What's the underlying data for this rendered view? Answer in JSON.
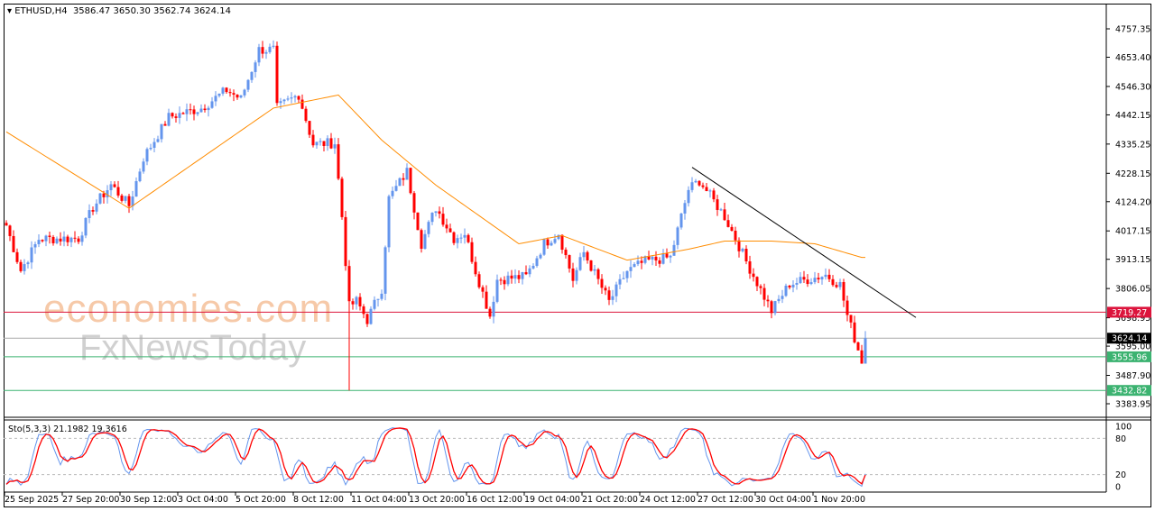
{
  "header": {
    "symbol": "ETHUSD,H4",
    "open": "3586.47",
    "high": "3650.30",
    "low": "3562.74",
    "close": "3624.14"
  },
  "watermarks": [
    "economies.com",
    "FxNewsToday"
  ],
  "colors": {
    "bull": "#6495ed",
    "bear": "#ff0000",
    "ma": "#ff8c00",
    "level_red": "#dc143c",
    "level_green": "#3cb371",
    "current": "#000000"
  },
  "chart_data": {
    "type": "candlestick",
    "symbol": "ETHUSD",
    "timeframe": "H4",
    "ylim": [
      3383.95,
      4757.35
    ],
    "y_ticks": [
      "4757.35",
      "4653.40",
      "4546.30",
      "4442.15",
      "4335.25",
      "4228.15",
      "4124.20",
      "4017.15",
      "3913.15",
      "3806.05",
      "3698.95",
      "3595.00",
      "3487.90",
      "3383.95"
    ],
    "x_ticks": [
      "25 Sep 2025",
      "27 Sep 20:00",
      "30 Sep 12:00",
      "3 Oct 04:00",
      "5 Oct 20:00",
      "8 Oct 12:00",
      "11 Oct 04:00",
      "13 Oct 20:00",
      "16 Oct 12:00",
      "19 Oct 04:00",
      "21 Oct 20:00",
      "24 Oct 12:00",
      "27 Oct 12:00",
      "30 Oct 04:00",
      "1 Nov 20:00"
    ],
    "price_path_candle_index_vs_price": [
      [
        0,
        4037
      ],
      [
        4,
        3872
      ],
      [
        9,
        3988
      ],
      [
        20,
        3990
      ],
      [
        24,
        4103
      ],
      [
        29,
        4186
      ],
      [
        34,
        4110
      ],
      [
        38,
        4285
      ],
      [
        45,
        4434
      ],
      [
        54,
        4467
      ],
      [
        61,
        4533
      ],
      [
        65,
        4500
      ],
      [
        70,
        4681
      ],
      [
        74,
        4681
      ],
      [
        75,
        4467
      ],
      [
        81,
        4517
      ],
      [
        85,
        4335
      ],
      [
        91,
        4340
      ],
      [
        93,
        4070
      ],
      [
        95,
        3740
      ],
      [
        97,
        3760
      ],
      [
        100,
        3691
      ],
      [
        104,
        3806
      ],
      [
        106,
        4136
      ],
      [
        111,
        4235
      ],
      [
        115,
        3971
      ],
      [
        119,
        4103
      ],
      [
        124,
        3990
      ],
      [
        127,
        4010
      ],
      [
        130,
        3872
      ],
      [
        134,
        3707
      ],
      [
        136,
        3839
      ],
      [
        144,
        3850
      ],
      [
        149,
        3971
      ],
      [
        153,
        4010
      ],
      [
        157,
        3839
      ],
      [
        160,
        3938
      ],
      [
        167,
        3757
      ],
      [
        172,
        3870
      ],
      [
        177,
        3905
      ],
      [
        184,
        3920
      ],
      [
        189,
        4169
      ],
      [
        192,
        4202
      ],
      [
        199,
        4070
      ],
      [
        202,
        3990
      ],
      [
        205,
        3905
      ],
      [
        212,
        3724
      ],
      [
        217,
        3823
      ],
      [
        227,
        3856
      ],
      [
        231,
        3820
      ],
      [
        233,
        3707
      ],
      [
        237,
        3542
      ],
      [
        238,
        3624.14
      ]
    ],
    "moving_average": [
      [
        0,
        4380
      ],
      [
        34,
        4100
      ],
      [
        74,
        4467
      ],
      [
        92,
        4515
      ],
      [
        104,
        4350
      ],
      [
        119,
        4185
      ],
      [
        142,
        3970
      ],
      [
        154,
        4000
      ],
      [
        172,
        3910
      ],
      [
        189,
        3950
      ],
      [
        199,
        3980
      ],
      [
        212,
        3980
      ],
      [
        224,
        3970
      ],
      [
        237,
        3920
      ]
    ],
    "levels": [
      {
        "label": "3719.27",
        "kind": "resistance"
      },
      {
        "label": "3624.14",
        "kind": "current"
      },
      {
        "label": "3555.96",
        "kind": "support"
      },
      {
        "label": "3432.82",
        "kind": "support"
      }
    ],
    "trendline": [
      [
        190,
        4250
      ],
      [
        252,
        3700
      ]
    ],
    "stochastic": {
      "label": "Sto(5,3,3) 21.1982 19.3616",
      "levels": [
        "100",
        "80",
        "20",
        "0"
      ],
      "k_last": 21.1982,
      "d_last": 19.3616
    }
  }
}
